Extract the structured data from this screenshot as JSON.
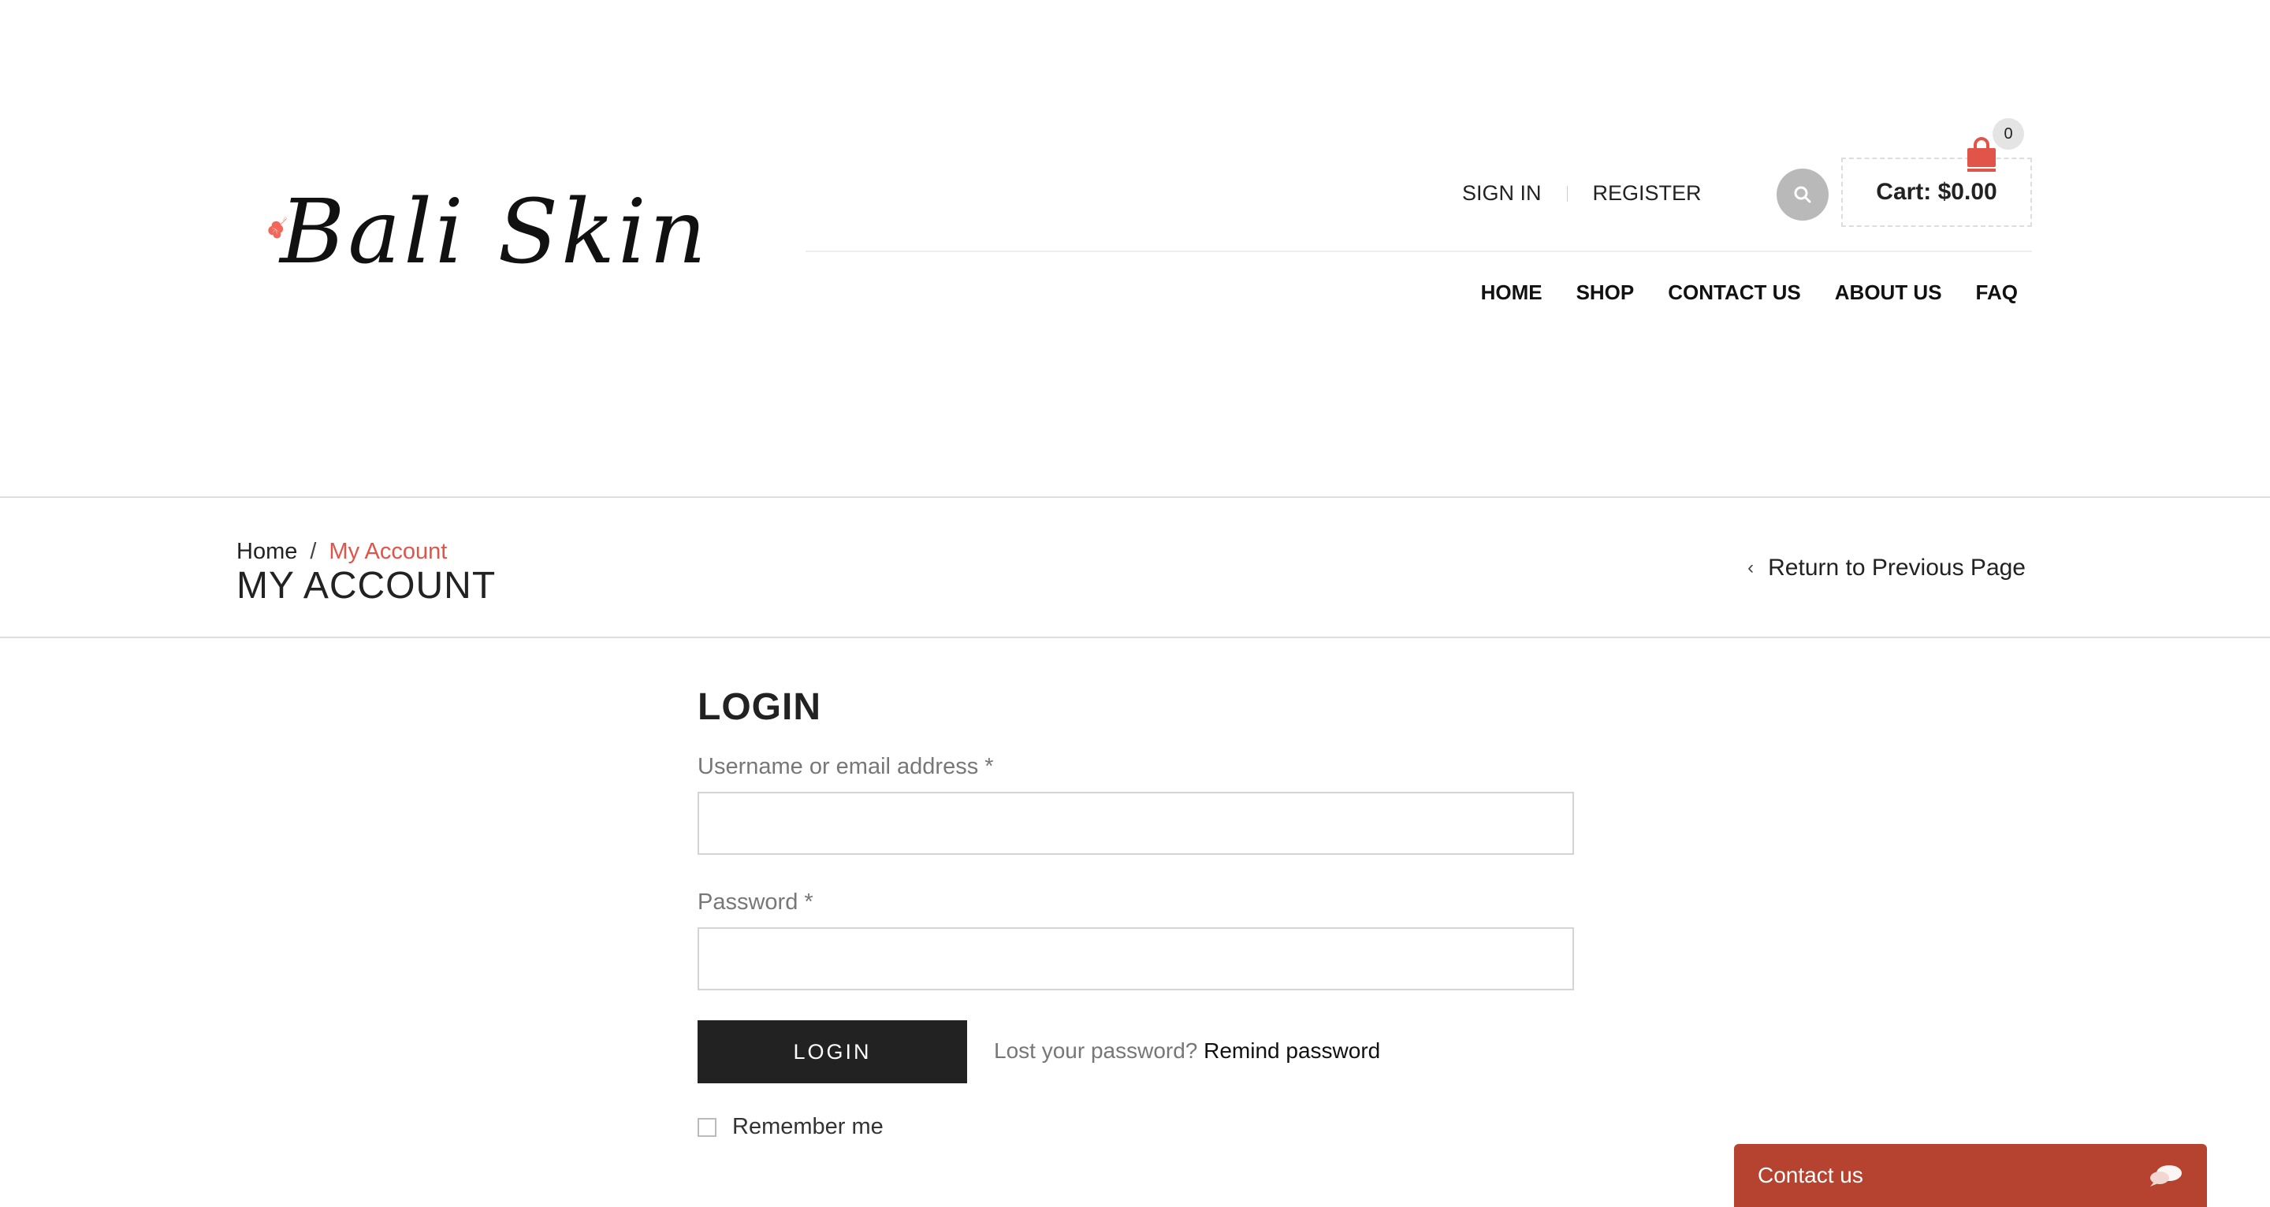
{
  "brand": {
    "name": "Bali Skin",
    "accent": "#f4665a"
  },
  "top_links": {
    "sign_in": "SIGN IN",
    "register": "REGISTER"
  },
  "cart": {
    "label": "Cart: $0.00",
    "count": "0"
  },
  "nav": {
    "items": [
      "HOME",
      "SHOP",
      "CONTACT US",
      "ABOUT US",
      "FAQ"
    ]
  },
  "breadcrumb": {
    "home": "Home",
    "separator": "/",
    "current": "My Account",
    "current_color": "#e0544a"
  },
  "page": {
    "title": "MY ACCOUNT",
    "return_link": "Return to Previous Page",
    "return_icon": "chevron-left-icon"
  },
  "login": {
    "title": "LOGIN",
    "username_label": "Username or email address *",
    "username_value": "",
    "password_label": "Password *",
    "password_value": "",
    "button": "LOGIN",
    "lost_password_text": "Lost your password?",
    "remind_link": "Remind password",
    "remember_me": "Remember me"
  },
  "contact_widget": {
    "label": "Contact us",
    "color": "#b5432f"
  },
  "icons": {
    "search": "search-icon",
    "cart": "shopping-bag-icon",
    "chat": "chat-bubbles-icon"
  }
}
